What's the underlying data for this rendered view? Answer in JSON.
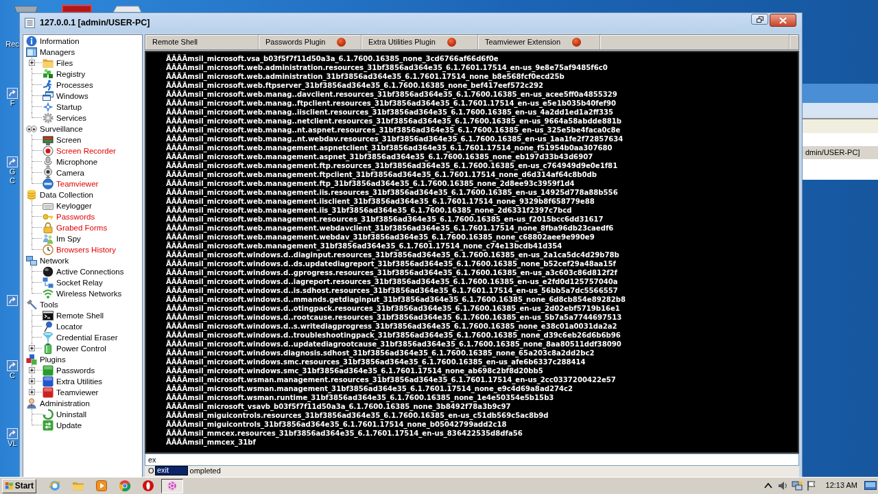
{
  "desktop": {
    "icons": [
      {
        "label": "Rec"
      },
      {
        "label": "F"
      },
      {
        "label": "G C"
      },
      {
        "label": "C"
      },
      {
        "label": "VL"
      }
    ],
    "background_window": {
      "text": "dmin/USER-PC]"
    }
  },
  "window": {
    "title": "127.0.0.1 [admin/USER-PC]"
  },
  "sidebar": {
    "items": [
      {
        "label": "Information"
      },
      {
        "label": "Managers",
        "children": [
          {
            "label": "Files",
            "expanded": false,
            "highlighted": false
          },
          {
            "label": "Registry",
            "highlighted": false
          },
          {
            "label": "Processes",
            "highlighted": false
          },
          {
            "label": "Windows",
            "highlighted": false
          },
          {
            "label": "Startup",
            "highlighted": false
          },
          {
            "label": "Services",
            "highlighted": false
          }
        ]
      },
      {
        "label": "Surveillance",
        "children": [
          {
            "label": "Screen",
            "highlighted": false
          },
          {
            "label": "Screen Recorder",
            "highlighted": true
          },
          {
            "label": "Microphone",
            "highlighted": false
          },
          {
            "label": "Camera",
            "highlighted": false
          },
          {
            "label": "Teamviewer",
            "highlighted": true
          }
        ]
      },
      {
        "label": "Data Collection",
        "children": [
          {
            "label": "Keylogger",
            "highlighted": false
          },
          {
            "label": "Passwords",
            "highlighted": true
          },
          {
            "label": "Grabed Forms",
            "highlighted": true
          },
          {
            "label": "Im Spy",
            "highlighted": false
          },
          {
            "label": "Browsers History",
            "highlighted": true
          }
        ]
      },
      {
        "label": "Network",
        "children": [
          {
            "label": "Active Connections",
            "highlighted": false
          },
          {
            "label": "Socket Relay",
            "highlighted": false
          },
          {
            "label": "Wireless Networks",
            "highlighted": false
          }
        ]
      },
      {
        "label": "Tools",
        "children": [
          {
            "label": "Remote Shell",
            "highlighted": false
          },
          {
            "label": "Locator",
            "highlighted": false
          },
          {
            "label": "Credential Eraser",
            "highlighted": false
          },
          {
            "label": "Power Control",
            "expanded": false,
            "highlighted": false
          }
        ]
      },
      {
        "label": "Plugins",
        "children": [
          {
            "label": "Passwords",
            "expanded": false,
            "highlighted": false
          },
          {
            "label": "Extra Utilities",
            "expanded": false,
            "highlighted": false
          },
          {
            "label": "Teamviewer",
            "expanded": false,
            "highlighted": false
          }
        ]
      },
      {
        "label": "Administration",
        "children": [
          {
            "label": "Uninstall",
            "highlighted": false
          },
          {
            "label": "Update",
            "highlighted": false
          }
        ]
      }
    ]
  },
  "tabs": [
    {
      "label": "Remote Shell",
      "dot": false
    },
    {
      "label": "Passwords Plugin",
      "dot": true
    },
    {
      "label": "Extra Utilities Plugin",
      "dot": true
    },
    {
      "label": "Teamviewer Extension",
      "dot": true
    }
  ],
  "shell": {
    "lines": [
      "ÃÄÄÄmsil_microsoft.vsa_b03f5f7f11d50a3a_6.1.7600.16385_none_3cd6766af66d6f0e",
      "ÃÄÄÄmsil_microsoft.web.administration.resources_31bf3856ad364e35_6.1.7601.17514_en-us_9e8e75af9485f6c0",
      "ÃÄÄÄmsil_microsoft.web.administration_31bf3856ad364e35_6.1.7601.17514_none_b8e568fcf0ecd25b",
      "ÃÄÄÄmsil_microsoft.web.ftpserver_31bf3856ad364e35_6.1.7600.16385_none_bef417eef572c292",
      "ÃÄÄÄmsil_microsoft.web.manag..davclient.resources_31bf3856ad364e35_6.1.7600.16385_en-us_acee5ff0a4855329",
      "ÃÄÄÄmsil_microsoft.web.manag..ftpclient.resources_31bf3856ad364e35_6.1.7601.17514_en-us_e5e1b035b40fef90",
      "ÃÄÄÄmsil_microsoft.web.manag..iisclient.resources_31bf3856ad364e35_6.1.7600.16385_en-us_4a2dd1ed1a2ff335",
      "ÃÄÄÄmsil_microsoft.web.manag..netclient.resources_31bf3856ad364e35_6.1.7600.16385_en-us_9664a58abdde881b",
      "ÃÄÄÄmsil_microsoft.web.manag..nt.aspnet.resources_31bf3856ad364e35_6.1.7600.16385_en-us_325e5be4faca0c8e",
      "ÃÄÄÄmsil_microsoft.web.manag..nt.webdav.resources_31bf3856ad364e35_6.1.7600.16385_en-us_1aa1fe2f72857634",
      "ÃÄÄÄmsil_microsoft.web.management.aspnetclient_31bf3856ad364e35_6.1.7601.17514_none_f51954b0aa307680",
      "ÃÄÄÄmsil_microsoft.web.management.aspnet_31bf3856ad364e35_6.1.7600.16385_none_eb197d33b43d6907",
      "ÃÄÄÄmsil_microsoft.web.management.ftp.resources_31bf3856ad364e35_6.1.7600.16385_en-us_c764949d9e0e1f81",
      "ÃÄÄÄmsil_microsoft.web.management.ftpclient_31bf3856ad364e35_6.1.7601.17514_none_d6d314af64c8b0db",
      "ÃÄÄÄmsil_microsoft.web.management.ftp_31bf3856ad364e35_6.1.7600.16385_none_2d8ee93c3959f1d4",
      "ÃÄÄÄmsil_microsoft.web.management.iis.resources_31bf3856ad364e35_6.1.7600.16385_en-us_14925d778a88b556",
      "ÃÄÄÄmsil_microsoft.web.management.iisclient_31bf3856ad364e35_6.1.7601.17514_none_9329b8f658779e88",
      "ÃÄÄÄmsil_microsoft.web.management.iis_31bf3856ad364e35_6.1.7600.16385_none_2d6331f2397c7bcd",
      "ÃÄÄÄmsil_microsoft.web.management.resources_31bf3856ad364e35_6.1.7600.16385_en-us_f2015bcc6dd31617",
      "ÃÄÄÄmsil_microsoft.web.management.webdavclient_31bf3856ad364e35_6.1.7601.17514_none_8fba96db23caedf6",
      "ÃÄÄÄmsil_microsoft.web.management.webdav_31bf3856ad364e35_6.1.7600.16385_none_c68802aee9e990e9",
      "ÃÄÄÄmsil_microsoft.web.management_31bf3856ad364e35_6.1.7601.17514_none_c74e13bcdb41d354",
      "ÃÄÄÄmsil_microsoft.windows.d..diaginput.resources_31bf3856ad364e35_6.1.7600.16385_en-us_2a1ca5dc4d29b78b",
      "ÃÄÄÄmsil_microsoft.windows.d..ds.updatediagreport_31bf3856ad364e35_6.1.7600.16385_none_b52cef29a48aa15f",
      "ÃÄÄÄmsil_microsoft.windows.d..gprogress.resources_31bf3856ad364e35_6.1.7600.16385_en-us_a3c603c86d812f2f",
      "ÃÄÄÄmsil_microsoft.windows.d..iagreport.resources_31bf3856ad364e35_6.1.7600.16385_en-us_e2fd0d125757040a",
      "ÃÄÄÄmsil_microsoft.windows.d..is.sdhost.resources_31bf3856ad364e35_6.1.7601.17514_en-us_56bb5a7dc5566557",
      "ÃÄÄÄmsil_microsoft.windows.d..mmands.getdiaginput_31bf3856ad364e35_6.1.7600.16385_none_6d8cb854e89282b8",
      "ÃÄÄÄmsil_microsoft.windows.d..otingpack.resources_31bf3856ad364e35_6.1.7600.16385_en-us_2d02ebf5719b16e1",
      "ÃÄÄÄmsil_microsoft.windows.d..rootcause.resources_31bf3856ad364e35_6.1.7600.16385_en-us_5b7a5a7744697513",
      "ÃÄÄÄmsil_microsoft.windows.d..s.writediagprogress_31bf3856ad364e35_6.1.7600.16385_none_e38c01a0031da2a2",
      "ÃÄÄÄmsil_microsoft.windows.d..troubleshootingpack_31bf3856ad364e35_6.1.7600.16385_none_d39c6eb26d6b6b96",
      "ÃÄÄÄmsil_microsoft.windows.d..updatediagrootcause_31bf3856ad364e35_6.1.7600.16385_none_8aa80511ddf38090",
      "ÃÄÄÄmsil_microsoft.windows.diagnosis.sdhost_31bf3856ad364e35_6.1.7600.16385_none_65a203c8a2dd2bc2",
      "ÃÄÄÄmsil_microsoft.windows.smc.resources_31bf3856ad364e35_6.1.7600.16385_en-us_afe6b6337c288414",
      "ÃÄÄÄmsil_microsoft.windows.smc_31bf3856ad364e35_6.1.7601.17514_none_ab698c2bf8d20bb5",
      "ÃÄÄÄmsil_microsoft.wsman.management.resources_31bf3856ad364e35_6.1.7601.17514_en-us_2cc0337200422e57",
      "ÃÄÄÄmsil_microsoft.wsman.management_31bf3856ad364e35_6.1.7601.17514_none_e9c4d69a8ad274c2",
      "ÃÄÄÄmsil_microsoft.wsman.runtime_31bf3856ad364e35_6.1.7600.16385_none_1e4e50354e5b15b3",
      "ÃÄÄÄmsil_microsoft_vsavb_b03f5f7f11d50a3a_6.1.7600.16385_none_3b8492f78a3b9c97",
      "ÃÄÄÄmsil_miguicontrols.resources_31bf3856ad364e35_6.1.7600.16385_en-us_c51db569c5ac8b9d",
      "ÃÄÄÄmsil_miguicontrols_31bf3856ad364e35_6.1.7601.17514_none_b05042799add2c18",
      "ÃÄÄÄmsil_mmcex.resources_31bf3856ad364e35_6.1.7601.17514_en-us_836422535d8dfa56",
      "ÃÄÄÄmsil_mmcex_31bf"
    ],
    "input": {
      "value": "ex"
    },
    "suggestions": [
      {
        "label": "exit",
        "selected": true
      }
    ]
  },
  "status_bar": {
    "parts": [
      "O",
      "ompleted"
    ]
  },
  "taskbar": {
    "start": "Start",
    "clock": "12:13 AM"
  }
}
